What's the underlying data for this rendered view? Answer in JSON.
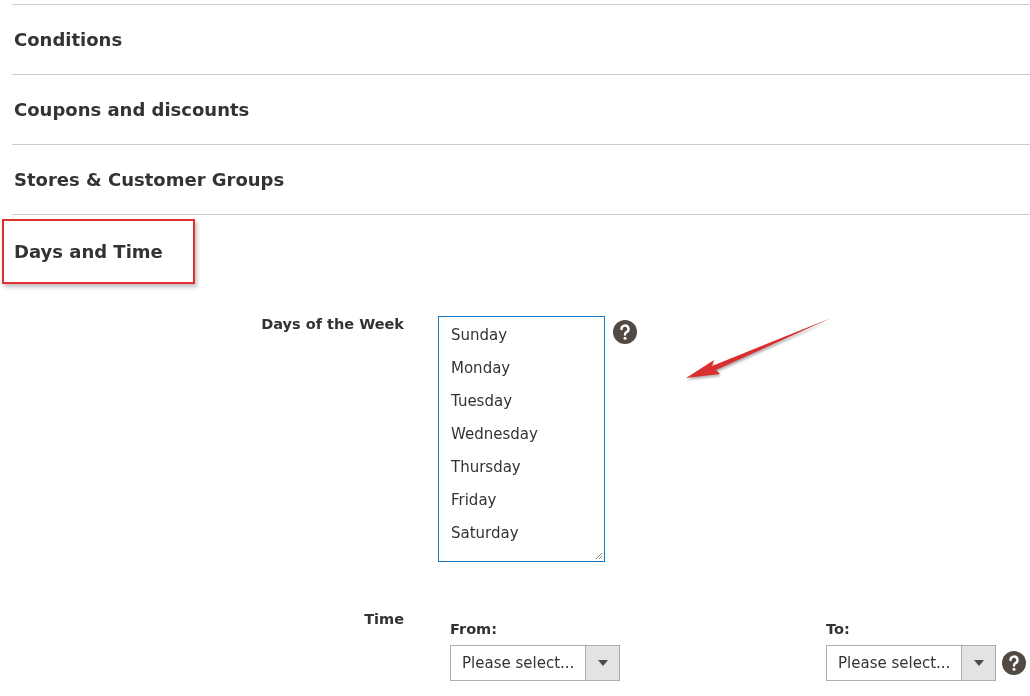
{
  "sections": [
    {
      "title": "Conditions",
      "highlighted": false
    },
    {
      "title": "Coupons and discounts",
      "highlighted": false
    },
    {
      "title": "Stores & Customer Groups",
      "highlighted": false
    },
    {
      "title": "Days and Time",
      "highlighted": true
    }
  ],
  "days_field": {
    "label": "Days of the Week",
    "options": [
      "Sunday",
      "Monday",
      "Tuesday",
      "Wednesday",
      "Thursday",
      "Friday",
      "Saturday"
    ]
  },
  "time_field": {
    "label": "Time",
    "from": {
      "label": "From:",
      "placeholder": "Please select..."
    },
    "to": {
      "label": "To:",
      "placeholder": "Please select..."
    }
  }
}
